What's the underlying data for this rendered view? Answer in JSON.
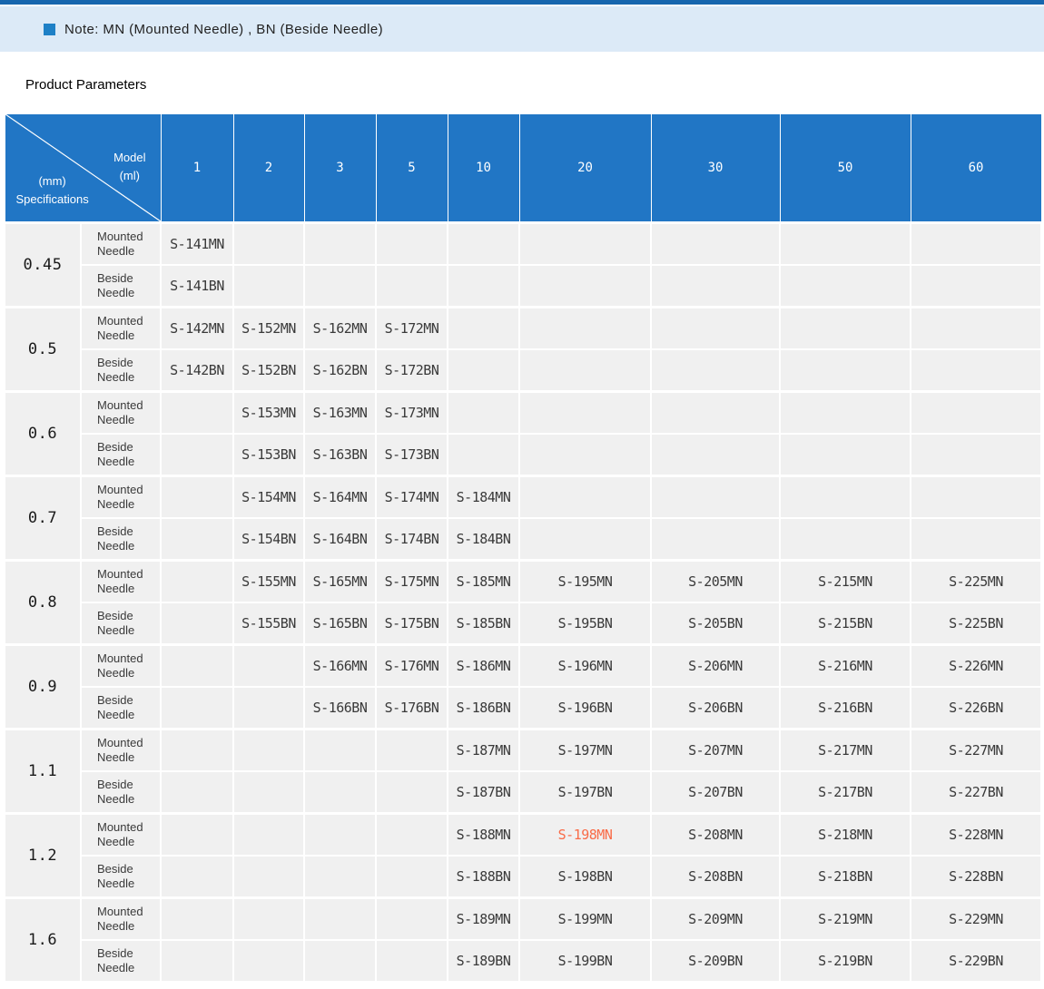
{
  "note": {
    "text": "Note: MN (Mounted Needle) , BN (Beside Needle)"
  },
  "section_title": "Product Parameters",
  "colors": {
    "accent_blue": "#2176C5",
    "top_line_blue": "#1666AE",
    "banner_blue": "#DCEAF7",
    "note_square_blue": "#1E80C6",
    "cell_gray": "#F0F0F0",
    "highlight_orange": "#F96B47"
  },
  "table": {
    "corner": {
      "model_label": "Model",
      "model_unit": "(ml)",
      "spec_unit": "(mm)",
      "spec_label": "Specifications"
    },
    "columns": [
      "1",
      "2",
      "3",
      "5",
      "10",
      "20",
      "30",
      "50",
      "60"
    ],
    "row_labels": {
      "mounted": "Mounted Needle",
      "beside": "Beside Needle"
    },
    "highlight": {
      "spec": "1.2",
      "needle": "mounted",
      "col_index": 5,
      "color": "#F96B47"
    },
    "rows": [
      {
        "spec": "0.45",
        "mounted": [
          "S-141MN",
          "",
          "",
          "",
          "",
          "",
          "",
          "",
          ""
        ],
        "beside": [
          "S-141BN",
          "",
          "",
          "",
          "",
          "",
          "",
          "",
          ""
        ]
      },
      {
        "spec": "0.5",
        "mounted": [
          "S-142MN",
          "S-152MN",
          "S-162MN",
          "S-172MN",
          "",
          "",
          "",
          "",
          ""
        ],
        "beside": [
          "S-142BN",
          "S-152BN",
          "S-162BN",
          "S-172BN",
          "",
          "",
          "",
          "",
          ""
        ]
      },
      {
        "spec": "0.6",
        "mounted": [
          "",
          "S-153MN",
          "S-163MN",
          "S-173MN",
          "",
          "",
          "",
          "",
          ""
        ],
        "beside": [
          "",
          "S-153BN",
          "S-163BN",
          "S-173BN",
          "",
          "",
          "",
          "",
          ""
        ]
      },
      {
        "spec": "0.7",
        "mounted": [
          "",
          "S-154MN",
          "S-164MN",
          "S-174MN",
          "S-184MN",
          "",
          "",
          "",
          ""
        ],
        "beside": [
          "",
          "S-154BN",
          "S-164BN",
          "S-174BN",
          "S-184BN",
          "",
          "",
          "",
          ""
        ]
      },
      {
        "spec": "0.8",
        "mounted": [
          "",
          "S-155MN",
          "S-165MN",
          "S-175MN",
          "S-185MN",
          "S-195MN",
          "S-205MN",
          "S-215MN",
          "S-225MN"
        ],
        "beside": [
          "",
          "S-155BN",
          "S-165BN",
          "S-175BN",
          "S-185BN",
          "S-195BN",
          "S-205BN",
          "S-215BN",
          "S-225BN"
        ]
      },
      {
        "spec": "0.9",
        "mounted": [
          "",
          "",
          "S-166MN",
          "S-176MN",
          "S-186MN",
          "S-196MN",
          "S-206MN",
          "S-216MN",
          "S-226MN"
        ],
        "beside": [
          "",
          "",
          "S-166BN",
          "S-176BN",
          "S-186BN",
          "S-196BN",
          "S-206BN",
          "S-216BN",
          "S-226BN"
        ]
      },
      {
        "spec": "1.1",
        "mounted": [
          "",
          "",
          "",
          "",
          "S-187MN",
          "S-197MN",
          "S-207MN",
          "S-217MN",
          "S-227MN"
        ],
        "beside": [
          "",
          "",
          "",
          "",
          "S-187BN",
          "S-197BN",
          "S-207BN",
          "S-217BN",
          "S-227BN"
        ]
      },
      {
        "spec": "1.2",
        "mounted": [
          "",
          "",
          "",
          "",
          "S-188MN",
          "S-198MN",
          "S-208MN",
          "S-218MN",
          "S-228MN"
        ],
        "beside": [
          "",
          "",
          "",
          "",
          "S-188BN",
          "S-198BN",
          "S-208BN",
          "S-218BN",
          "S-228BN"
        ]
      },
      {
        "spec": "1.6",
        "mounted": [
          "",
          "",
          "",
          "",
          "S-189MN",
          "S-199MN",
          "S-209MN",
          "S-219MN",
          "S-229MN"
        ],
        "beside": [
          "",
          "",
          "",
          "",
          "S-189BN",
          "S-199BN",
          "S-209BN",
          "S-219BN",
          "S-229BN"
        ]
      }
    ]
  }
}
